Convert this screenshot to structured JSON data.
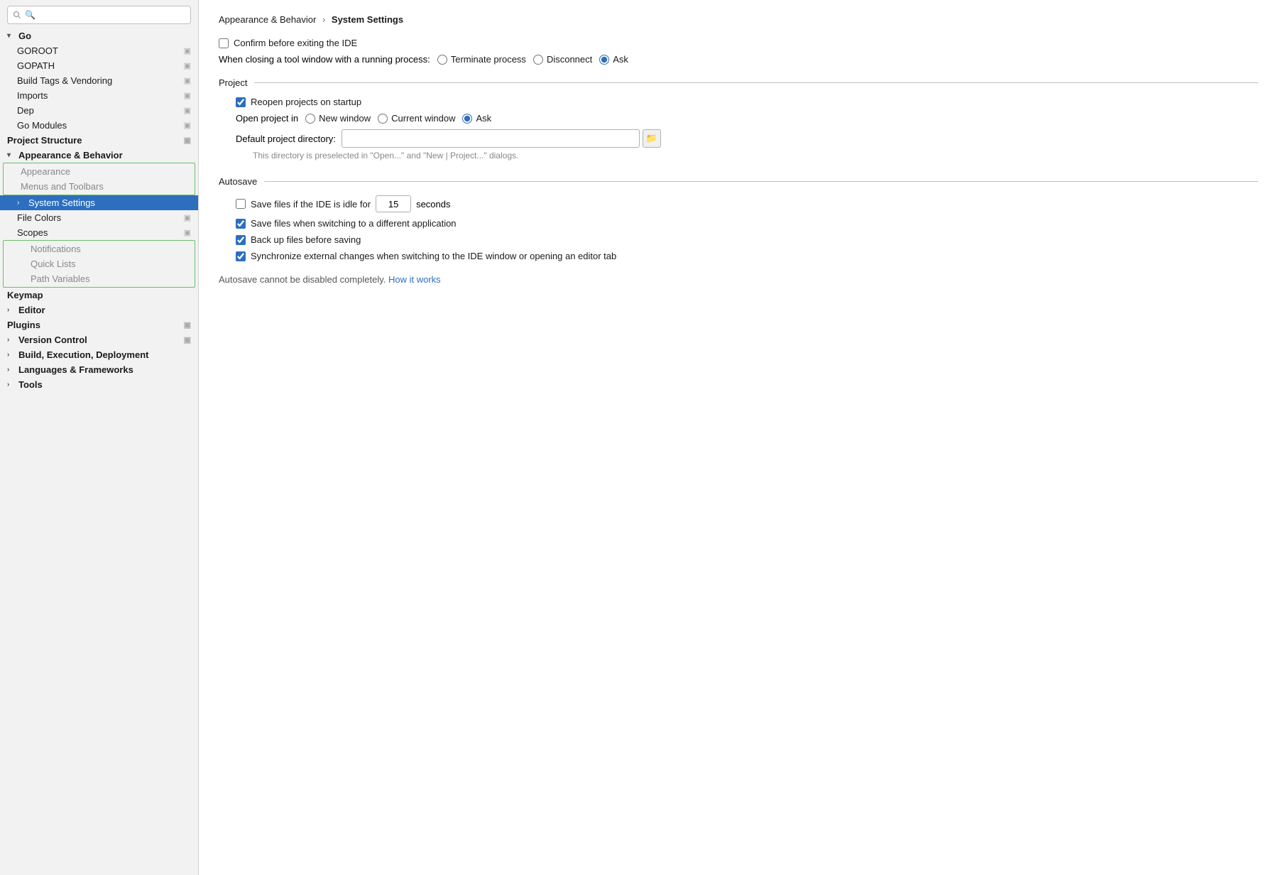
{
  "sidebar": {
    "search_placeholder": "🔍",
    "items": [
      {
        "id": "go",
        "label": "Go",
        "level": 0,
        "arrow": "▾",
        "bold": true,
        "icon": false
      },
      {
        "id": "goroot",
        "label": "GOROOT",
        "level": 1,
        "arrow": "",
        "bold": false,
        "icon": true
      },
      {
        "id": "gopath",
        "label": "GOPATH",
        "level": 1,
        "arrow": "",
        "bold": false,
        "icon": true
      },
      {
        "id": "build-tags",
        "label": "Build Tags & Vendoring",
        "level": 1,
        "arrow": "",
        "bold": false,
        "icon": true
      },
      {
        "id": "imports",
        "label": "Imports",
        "level": 1,
        "arrow": "",
        "bold": false,
        "icon": true
      },
      {
        "id": "dep",
        "label": "Dep",
        "level": 1,
        "arrow": "",
        "bold": false,
        "icon": true
      },
      {
        "id": "go-modules",
        "label": "Go Modules",
        "level": 1,
        "arrow": "",
        "bold": false,
        "icon": true
      },
      {
        "id": "project-structure",
        "label": "Project Structure",
        "level": 0,
        "arrow": "",
        "bold": true,
        "icon": true
      },
      {
        "id": "appearance-behavior",
        "label": "Appearance & Behavior",
        "level": 0,
        "arrow": "▾",
        "bold": true,
        "icon": false
      },
      {
        "id": "appearance",
        "label": "Appearance",
        "level": 1,
        "arrow": "",
        "bold": false,
        "icon": false,
        "greyed": true,
        "group_border": true
      },
      {
        "id": "menus-toolbars",
        "label": "Menus and Toolbars",
        "level": 1,
        "arrow": "",
        "bold": false,
        "icon": false,
        "greyed": true,
        "group_border": true
      },
      {
        "id": "system-settings",
        "label": "System Settings",
        "level": 1,
        "arrow": "›",
        "bold": false,
        "icon": false,
        "selected": true
      },
      {
        "id": "file-colors",
        "label": "File Colors",
        "level": 1,
        "arrow": "",
        "bold": false,
        "icon": true
      },
      {
        "id": "scopes",
        "label": "Scopes",
        "level": 1,
        "arrow": "",
        "bold": false,
        "icon": true
      },
      {
        "id": "notifications",
        "label": "Notifications",
        "level": 2,
        "arrow": "",
        "bold": false,
        "icon": false,
        "greyed": true,
        "group_border": true
      },
      {
        "id": "quick-lists",
        "label": "Quick Lists",
        "level": 2,
        "arrow": "",
        "bold": false,
        "icon": false,
        "greyed": true,
        "group_border": true
      },
      {
        "id": "path-variables",
        "label": "Path Variables",
        "level": 2,
        "arrow": "",
        "bold": false,
        "icon": false,
        "greyed": true,
        "group_border": true
      },
      {
        "id": "keymap",
        "label": "Keymap",
        "level": 0,
        "arrow": "",
        "bold": true,
        "icon": false
      },
      {
        "id": "editor",
        "label": "Editor",
        "level": 0,
        "arrow": "›",
        "bold": true,
        "icon": false
      },
      {
        "id": "plugins",
        "label": "Plugins",
        "level": 0,
        "arrow": "",
        "bold": true,
        "icon": true
      },
      {
        "id": "version-control",
        "label": "Version Control",
        "level": 0,
        "arrow": "›",
        "bold": true,
        "icon": true
      },
      {
        "id": "build-exec-deploy",
        "label": "Build, Execution, Deployment",
        "level": 0,
        "arrow": "›",
        "bold": true,
        "icon": false
      },
      {
        "id": "languages-frameworks",
        "label": "Languages & Frameworks",
        "level": 0,
        "arrow": "›",
        "bold": true,
        "icon": false
      },
      {
        "id": "tools",
        "label": "Tools",
        "level": 0,
        "arrow": "›",
        "bold": true,
        "icon": false
      }
    ]
  },
  "main": {
    "breadcrumb_parent": "Appearance & Behavior",
    "breadcrumb_sep": "›",
    "breadcrumb_current": "System Settings",
    "confirm_exit_label": "Confirm before exiting the IDE",
    "confirm_exit_checked": false,
    "tool_window_label": "When closing a tool window with a running process:",
    "terminate_label": "Terminate process",
    "disconnect_label": "Disconnect",
    "ask_label": "Ask",
    "terminate_checked": false,
    "disconnect_checked": false,
    "ask_checked": true,
    "project_section": "Project",
    "reopen_label": "Reopen projects on startup",
    "reopen_checked": true,
    "open_project_in_label": "Open project in",
    "new_window_label": "New window",
    "current_window_label": "Current window",
    "ask2_label": "Ask",
    "open_project_new_checked": false,
    "open_project_current_checked": false,
    "open_project_ask_checked": true,
    "default_dir_label": "Default project directory:",
    "default_dir_value": "",
    "default_dir_hint": "This directory is preselected in \"Open...\" and \"New | Project...\" dialogs.",
    "autosave_section": "Autosave",
    "save_idle_label": "Save files if the IDE is idle for",
    "save_idle_checked": false,
    "save_idle_seconds": "15",
    "save_idle_unit": "seconds",
    "save_switch_label": "Save files when switching to a different application",
    "save_switch_checked": true,
    "backup_label": "Back up files before saving",
    "backup_checked": true,
    "sync_label": "Synchronize external changes when switching to the IDE window or opening an editor tab",
    "sync_checked": true,
    "autosave_note": "Autosave cannot be disabled completely.",
    "how_it_works_label": "How it works"
  },
  "icons": {
    "folder": "📁",
    "settings": "⚙"
  }
}
